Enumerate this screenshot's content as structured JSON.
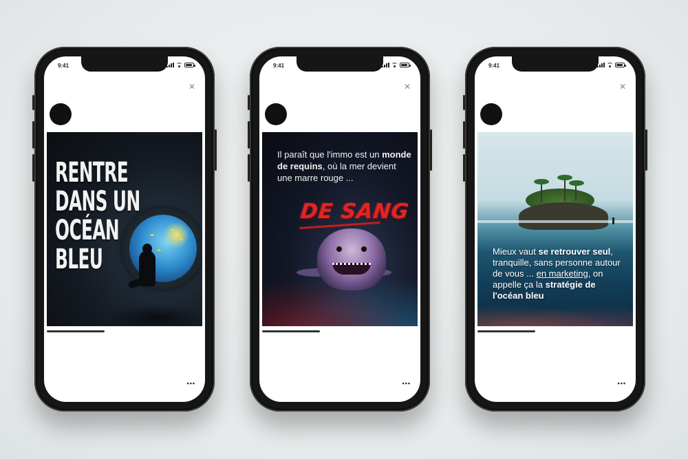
{
  "status_bar": {
    "time": "9:41"
  },
  "phones": [
    {
      "post": {
        "headline_lines": [
          "RENTRE",
          "DANS UN",
          "OCÉAN",
          "BLEU"
        ]
      }
    },
    {
      "post": {
        "intro_plain_1": "Il paraît que l'immo est un ",
        "intro_bold": "monde de requins",
        "intro_plain_2": ", où la mer devient une marre rouge ...",
        "accent_text": "DE SANG"
      }
    },
    {
      "post": {
        "text_1": "Mieux vaut ",
        "text_bold_1": "se retrouver seul",
        "text_2": ", tranquille, sans personne autour de vous ... ",
        "text_underlined": "en marketing",
        "text_3": ", on appelle ça la ",
        "text_bold_2": "stratégie de l'océan bleu"
      }
    }
  ],
  "controls": {
    "more_label": "•••",
    "close_label": "✕"
  },
  "icons": [
    "signal-icon",
    "wifi-icon",
    "battery-icon",
    "close-icon",
    "more-icon"
  ],
  "colors": {
    "accent_red": "#e32424",
    "phone_frame": "#161616",
    "text_light": "#f2f2f2"
  }
}
